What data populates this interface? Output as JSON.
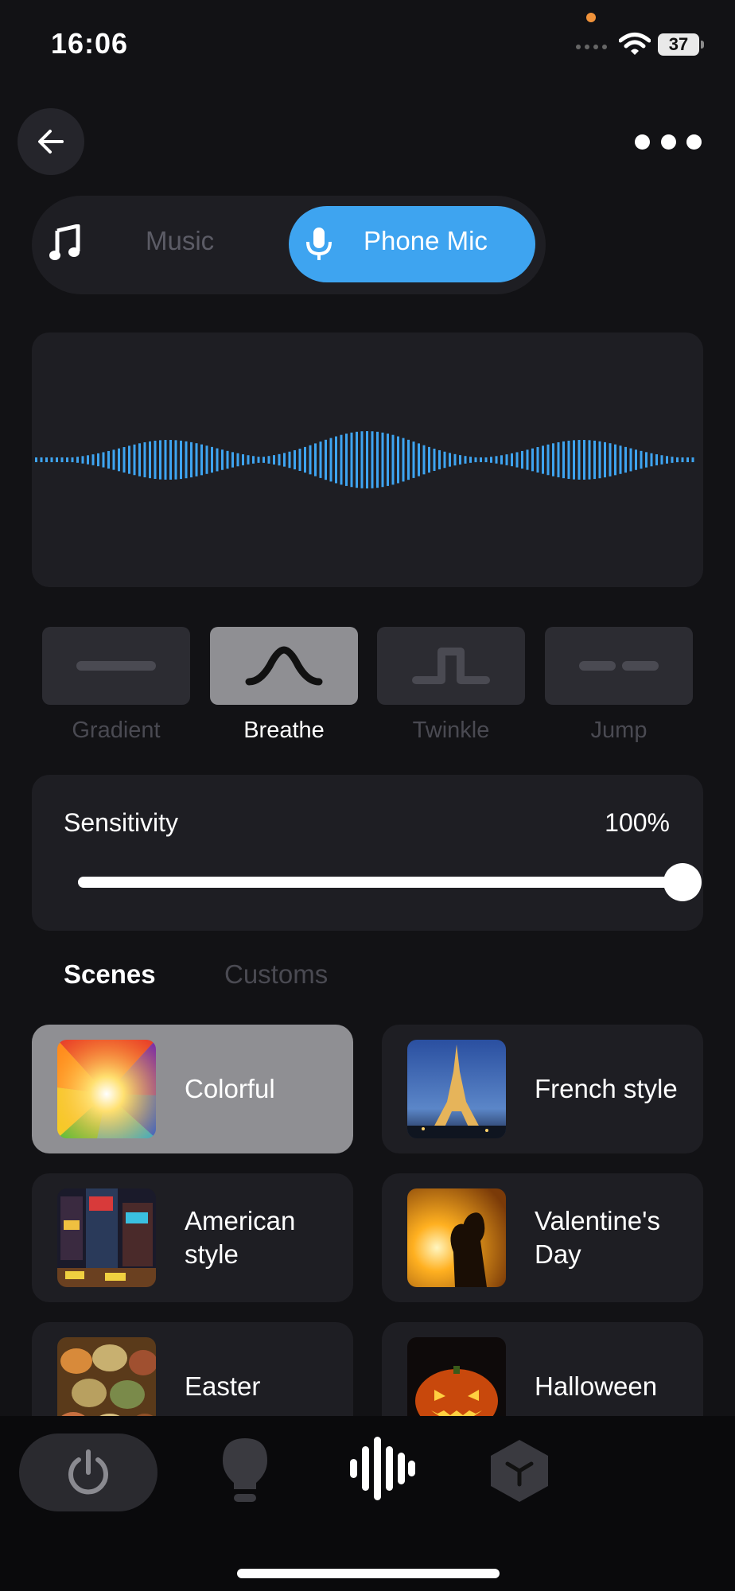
{
  "status_bar": {
    "time": "16:06",
    "battery": "37"
  },
  "source_toggle": {
    "music_label": "Music",
    "mic_label": "Phone Mic",
    "active": "Phone Mic"
  },
  "modes": [
    {
      "label": "Gradient",
      "icon": "gradient-line-icon"
    },
    {
      "label": "Breathe",
      "icon": "breathe-wave-icon"
    },
    {
      "label": "Twinkle",
      "icon": "twinkle-pulse-icon"
    },
    {
      "label": "Jump",
      "icon": "jump-dashes-icon"
    }
  ],
  "selected_mode": "Breathe",
  "sensitivity": {
    "label": "Sensitivity",
    "value_text": "100%",
    "value": 1.0
  },
  "scene_tabs": {
    "scenes": "Scenes",
    "customs": "Customs",
    "active": "Scenes"
  },
  "scenes": [
    {
      "name": "Colorful"
    },
    {
      "name": "French style"
    },
    {
      "name": "American style"
    },
    {
      "name": "Valentine's Day"
    },
    {
      "name": "Easter"
    },
    {
      "name": "Halloween"
    }
  ],
  "selected_scene": "Colorful",
  "colors": {
    "accent": "#3ea4f0",
    "background": "#121215",
    "card": "#1e1e23",
    "selected": "#8f8f93"
  },
  "bottom_nav": [
    "power-icon",
    "bulb-icon",
    "music-wave-icon",
    "cube-icon"
  ]
}
